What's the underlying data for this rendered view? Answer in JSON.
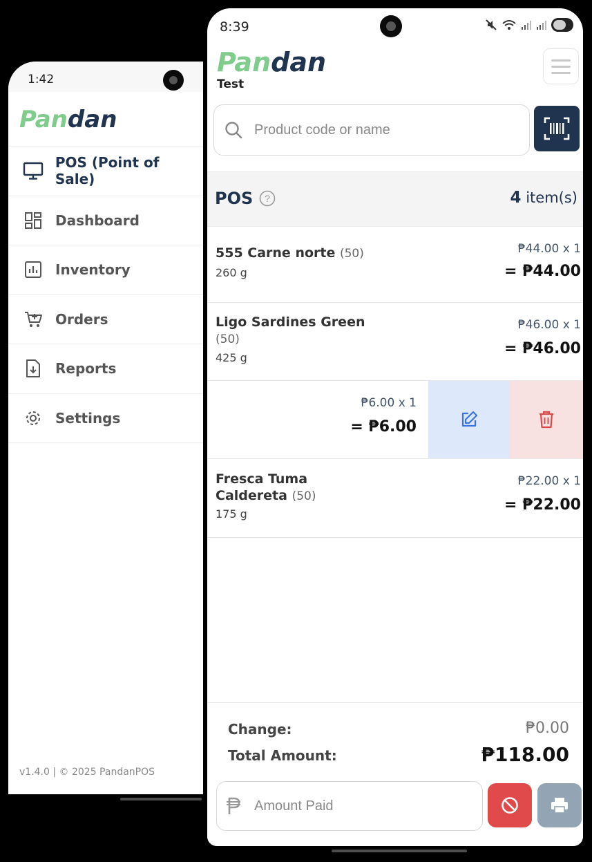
{
  "left_phone": {
    "status_time": "1:42",
    "logo_part1": "Pan",
    "logo_part2": "dan",
    "nav": [
      {
        "label": "POS (Point of Sale)",
        "icon": "monitor-icon",
        "active": true
      },
      {
        "label": "Dashboard",
        "icon": "dashboard-icon",
        "active": false
      },
      {
        "label": "Inventory",
        "icon": "chart-icon",
        "active": false
      },
      {
        "label": "Orders",
        "icon": "cart-icon",
        "active": false
      },
      {
        "label": "Reports",
        "icon": "file-download-icon",
        "active": false
      },
      {
        "label": "Settings",
        "icon": "gear-icon",
        "active": false
      }
    ],
    "footer": "v1.4.0 | © 2025 PandanPOS"
  },
  "right_phone": {
    "status_time": "8:39",
    "logo_part1": "Pan",
    "logo_part2": "dan",
    "store_name": "Test",
    "search": {
      "placeholder": "Product code or name"
    },
    "pos_header": {
      "title": "POS",
      "count": "4",
      "count_suffix": " item(s)"
    },
    "items": [
      {
        "name": "555 Carne norte",
        "stock": "(50)",
        "size": "260 g",
        "unit": "₱44.00 x 1",
        "total": "= ₱44.00"
      },
      {
        "name": "Ligo Sardines Green",
        "stock": "(50)",
        "size": "425 g",
        "unit": "₱46.00 x 1",
        "total": "= ₱46.00"
      },
      {
        "name": "",
        "stock": "",
        "size": "",
        "unit": "₱6.00 x 1",
        "total": "= ₱6.00"
      },
      {
        "name_line1": "Fresca Tuma",
        "name_line2": "Caldereta",
        "stock": "(50)",
        "size": "175 g",
        "unit": "₱22.00 x 1",
        "total": "= ₱22.00"
      }
    ],
    "summary": {
      "change_label": "Change:",
      "change_value": "₱0.00",
      "total_label": "Total Amount:",
      "total_value": "₱118.00"
    },
    "amount_paid": {
      "placeholder": "Amount Paid"
    }
  },
  "colors": {
    "brand_navy": "#20344f",
    "brand_green": "#7fcc8c",
    "danger": "#e04a4a",
    "print_disabled": "#93a5b4",
    "edit_bg": "#dde8fb",
    "delete_bg": "#f8e1e1"
  }
}
